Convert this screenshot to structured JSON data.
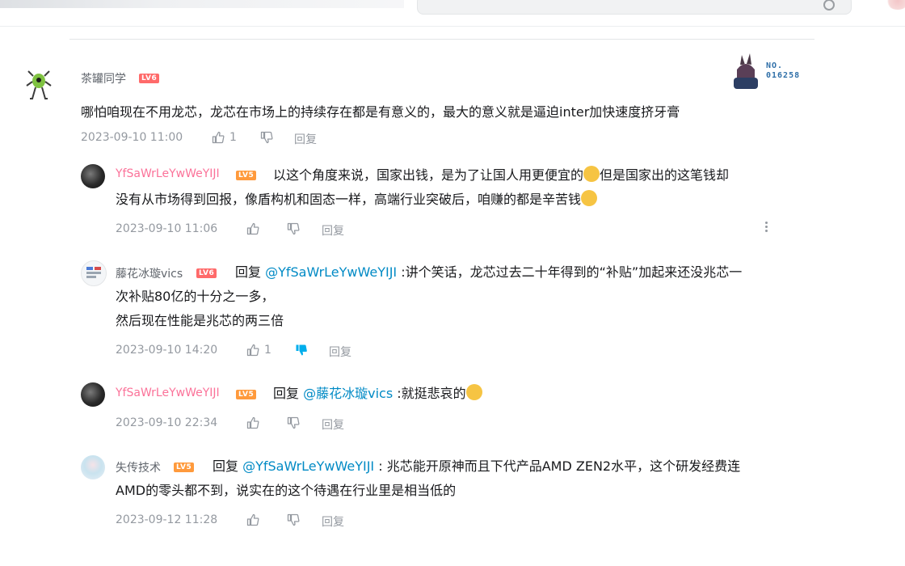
{
  "comments": [
    {
      "user": "茶罐同学",
      "level": "LV6",
      "text": "哪怕咱现在不用龙芯，龙芯在市场上的持续存在都是有意义的，最大的意义就是逼迫inter加快速度挤牙膏",
      "time": "2023-09-10 11:00",
      "likes": "1",
      "reply_label": "回复",
      "fan_badge": {
        "label": "NO.",
        "number": "016258"
      }
    },
    {
      "user": "YfSaWrLeYwWeYIJI",
      "level": "LV5",
      "text_line1": "以这个角度来说，国家出钱，是为了让国人用更便宜的",
      "text_line1b": "但是国家出的这笔钱却",
      "text_line2": "没有从市场得到回报，像盾构机和固态一样，高端行业突破后，咱赚的都是辛苦钱",
      "time": "2023-09-10 11:06",
      "reply_label": "回复"
    },
    {
      "user": "藤花冰璇vics",
      "level": "LV6",
      "reply_prefix": "回复",
      "at": "@YfSaWrLeYwWeYIJI",
      "text_line1": ":讲个笑话，龙芯过去二十年得到的“补贴”加起来还没兆芯一",
      "text_line2": "次补贴80亿的十分之一多，",
      "text_line3": "然后现在性能是兆芯的两三倍",
      "time": "2023-09-10 14:20",
      "likes": "1",
      "reply_label": "回复"
    },
    {
      "user": "YfSaWrLeYwWeYIJI",
      "level": "LV5",
      "reply_prefix": "回复",
      "at": "@藤花冰璇vics",
      "text": ":就挺悲哀的",
      "time": "2023-09-10 22:34",
      "reply_label": "回复"
    },
    {
      "user": "失传技术",
      "level": "LV5",
      "reply_prefix": "回复",
      "at": "@YfSaWrLeYwWeYIJI",
      "text_line1": ": 兆芯能开原神而且下代产品AMD ZEN2水平，这个研发经费连",
      "text_line2": "AMD的零头都不到，说实在的这个待遇在行业里是相当低的",
      "time": "2023-09-12 11:28",
      "reply_label": "回复"
    }
  ],
  "colors": {
    "name_default": "#61666d",
    "name_vip": "#fb7299",
    "link": "#008ac5",
    "meta": "#9499a0",
    "lv6": "#ff6a6a",
    "lv5": "#ff9a3c",
    "dislike_active": "#00aeec"
  },
  "icons": [
    "thumb-up-icon",
    "thumb-down-icon",
    "more-icon",
    "search-icon"
  ]
}
